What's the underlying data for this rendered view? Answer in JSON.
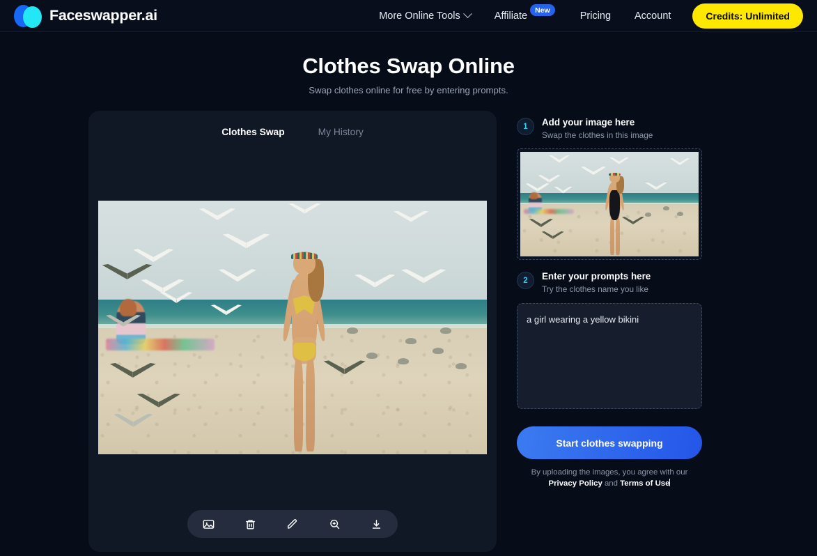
{
  "header": {
    "brand_name": "Faceswapper.ai",
    "nav": [
      {
        "label": "More Online Tools",
        "has_chevron": true
      },
      {
        "label": "Affiliate",
        "badge": "New"
      },
      {
        "label": "Pricing"
      },
      {
        "label": "Account"
      }
    ],
    "credits_label": "Credits: Unlimited",
    "colors": {
      "credits_bg": "#ffe800",
      "badge_bg": "#2563eb",
      "logo_blue": "#1768f5",
      "logo_cyan": "#22e8f5"
    }
  },
  "hero": {
    "title": "Clothes Swap Online",
    "subtitle": "Swap clothes online for free by entering prompts."
  },
  "workspace": {
    "tabs": [
      {
        "label": "Clothes Swap",
        "active": true
      },
      {
        "label": "My History",
        "active": false
      }
    ],
    "toolbar": [
      {
        "name": "image-icon",
        "title": "Image"
      },
      {
        "name": "trash-icon",
        "title": "Delete"
      },
      {
        "name": "pencil-icon",
        "title": "Edit"
      },
      {
        "name": "zoom-in-icon",
        "title": "Zoom in"
      },
      {
        "name": "download-icon",
        "title": "Download"
      }
    ]
  },
  "panel": {
    "step1": {
      "number": "1",
      "title": "Add your image here",
      "subtitle": "Swap the clothes in this image"
    },
    "step2": {
      "number": "2",
      "title": "Enter your prompts here",
      "subtitle": "Try the clothes name you like"
    },
    "prompt_value": "a girl wearing a yellow bikini",
    "prompt_placeholder": "Try the clothes name you like",
    "cta_label": "Start clothes swapping",
    "legal": {
      "prefix": "By uploading the images, you agree with our ",
      "link1": "Privacy Policy",
      "middle": " and ",
      "link2": "Terms of Use"
    }
  }
}
